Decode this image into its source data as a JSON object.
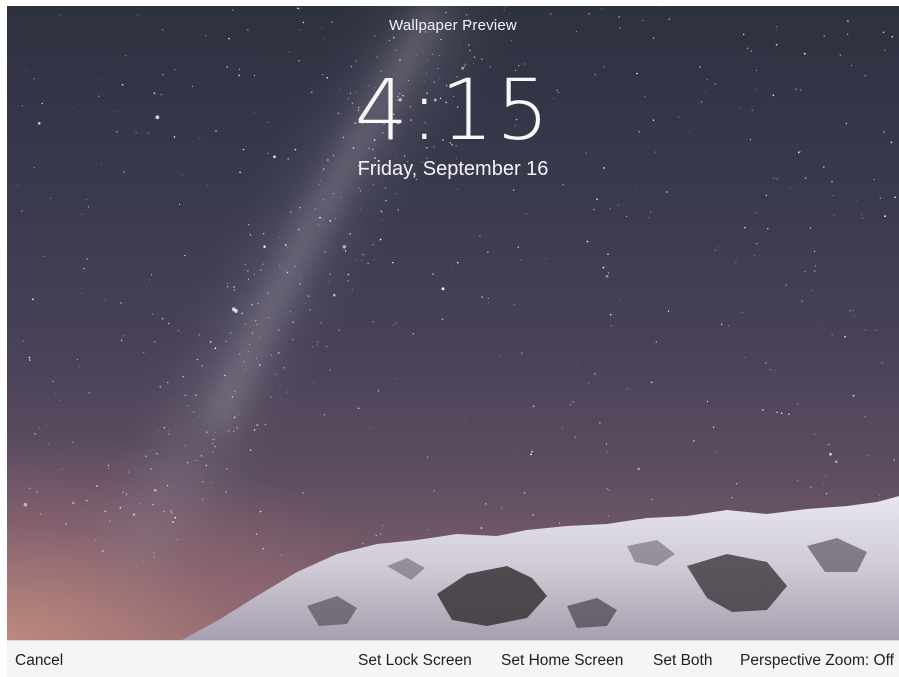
{
  "preview": {
    "title": "Wallpaper Preview"
  },
  "lockscreen": {
    "time": "4:15",
    "date": "Friday, September 16"
  },
  "toolbar": {
    "cancel_label": "Cancel",
    "set_lock_label": "Set Lock Screen",
    "set_home_label": "Set Home Screen",
    "set_both_label": "Set Both",
    "perspective_zoom_label": "Perspective Zoom: Off"
  },
  "colors": {
    "sky_top": "#2e3140",
    "sky_horizon": "#8e6a70",
    "toolbar_bg": "#f5f5f6",
    "toolbar_text": "#202020",
    "overlay_text": "#ffffff"
  }
}
